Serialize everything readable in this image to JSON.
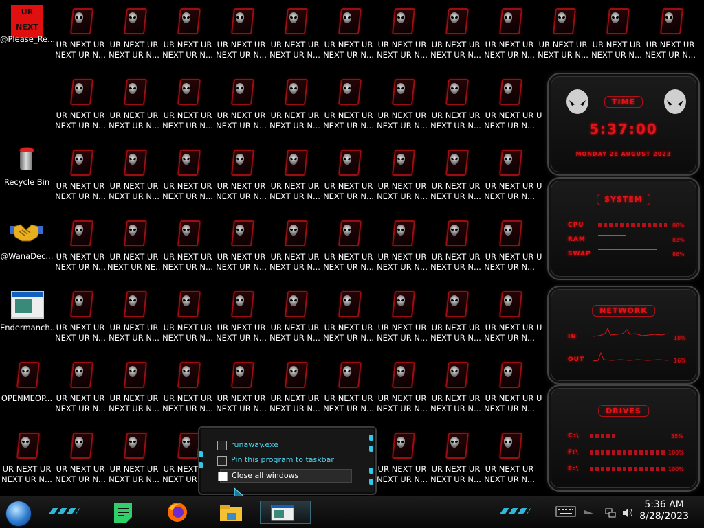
{
  "desktop": {
    "special_icons": [
      {
        "label": "@Please_Re...",
        "logo_line1": "UR",
        "logo_line2": "NEXT"
      },
      {
        "label": "Recycle Bin"
      },
      {
        "label": "@WanaDec..."
      },
      {
        "label": "Endermanch..."
      },
      {
        "label": "OPENMEOP..."
      }
    ],
    "tile_label_line1": "UR NEXT UR",
    "tile_label_line2": "NEXT UR N...",
    "tile_label_line2_alt": "NEXT UR NE...",
    "partial_label": "U"
  },
  "gadget": {
    "time": {
      "title": "TIME",
      "clock": "5:37:00",
      "date": "MONDAY 28 AUGUST 2023"
    },
    "system": {
      "title": "SYSTEM",
      "rows": [
        {
          "label": "CPU",
          "value": "88%",
          "level": 0.88
        },
        {
          "label": "RAM",
          "value": "83%",
          "level": 0.2
        },
        {
          "label": "SWAP",
          "value": "86%",
          "level": 0.55
        }
      ]
    },
    "network": {
      "title": "NETWORK",
      "rows": [
        {
          "label": "IN",
          "value": "18%"
        },
        {
          "label": "OUT",
          "value": "16%"
        }
      ]
    },
    "drives": {
      "title": "DRIVES",
      "rows": [
        {
          "label": "C:\\",
          "value": "35%",
          "level": 0.35
        },
        {
          "label": "F:\\",
          "value": "100%",
          "level": 1.0
        },
        {
          "label": "E:\\",
          "value": "100%",
          "level": 1.0
        }
      ]
    }
  },
  "jumplist": {
    "items": [
      {
        "label": "runaway.exe"
      },
      {
        "label": "Pin this program to taskbar"
      },
      {
        "label": "Close all windows"
      }
    ]
  },
  "taskbar": {
    "time": "5:36 AM",
    "date": "8/28/2023"
  },
  "colors": {
    "accent_red": "#e0141a",
    "accent_cyan": "#33c8e8"
  }
}
